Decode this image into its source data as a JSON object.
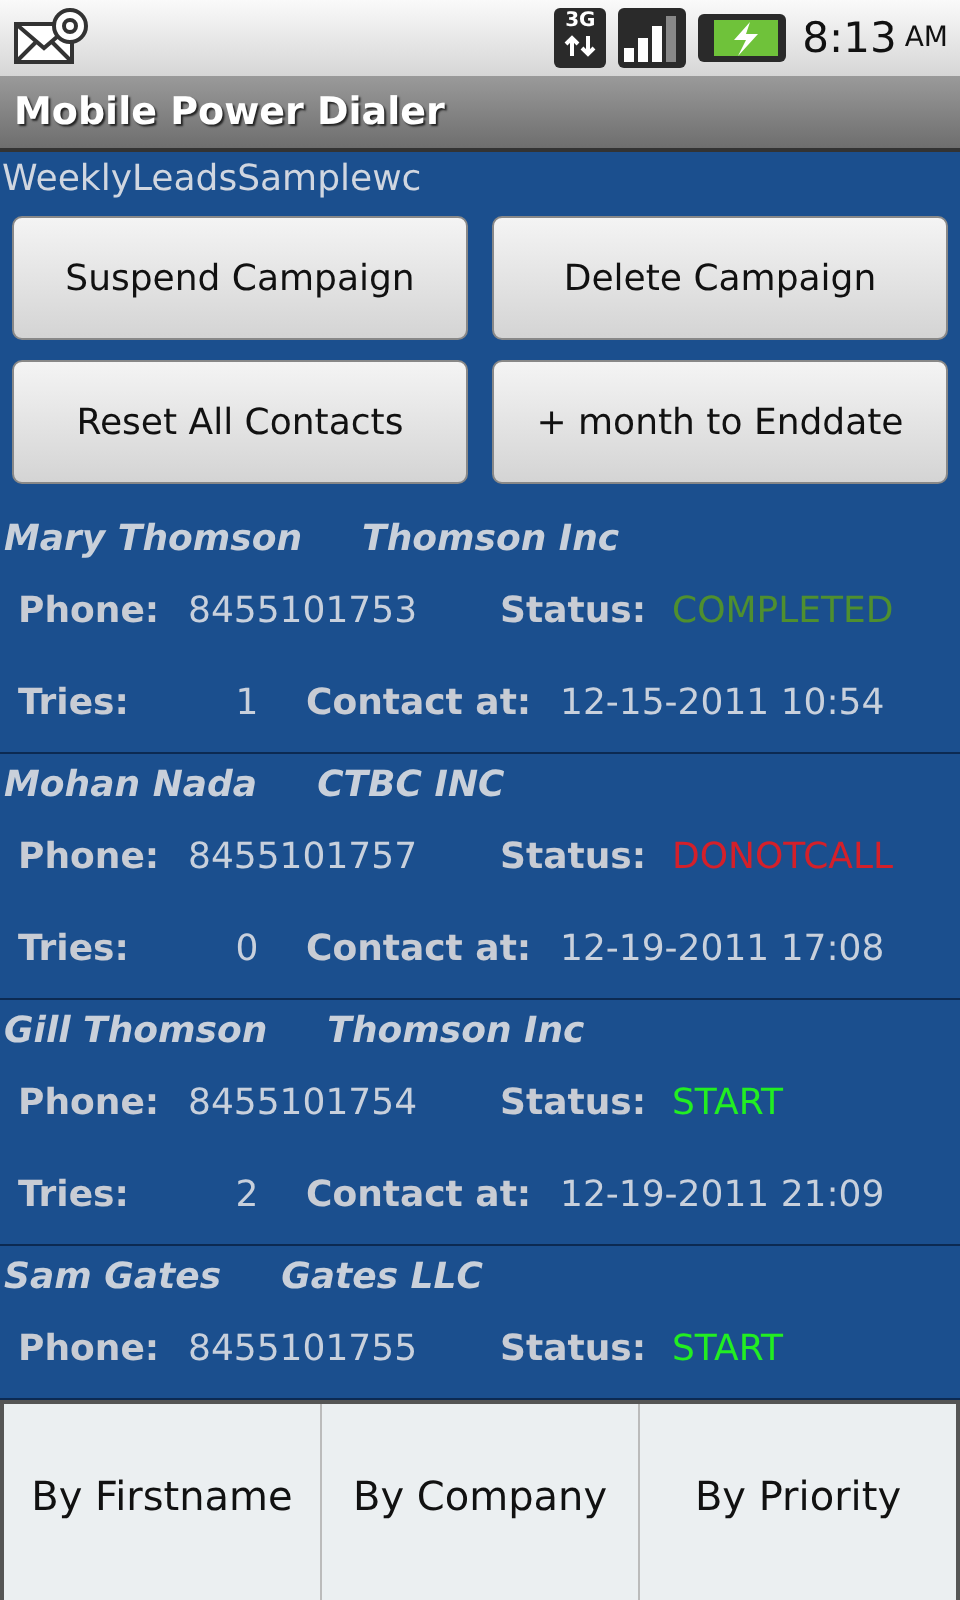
{
  "status_bar": {
    "time": "8:13",
    "ampm": "AM",
    "network": "3G"
  },
  "window": {
    "title": "Mobile Power Dialer"
  },
  "campaign": "WeeklyLeadsSamplewc",
  "buttons": [
    "Suspend Campaign",
    "Delete Campaign",
    "Reset All Contacts",
    "+ month to Enddate"
  ],
  "contacts": [
    {
      "name": "Mary Thomson",
      "company": "Thomson Inc",
      "phone_label": "Phone:",
      "phone": "8455101753",
      "status_label": "Status:",
      "status": "COMPLETED",
      "color": "#4f8f2f",
      "tries_label": "Tries:",
      "tries": "1",
      "contact_label": "Contact at:",
      "contact_at": "12-15-2011 10:54"
    },
    {
      "name": "Mohan Nada",
      "company": "CTBC INC",
      "phone_label": "Phone:",
      "phone": "8455101757",
      "status_label": "Status:",
      "status": "DONOTCALL",
      "color": "#d4202a",
      "tries_label": "Tries:",
      "tries": "0",
      "contact_label": "Contact at:",
      "contact_at": "12-19-2011 17:08"
    },
    {
      "name": "Gill Thomson",
      "company": "Thomson Inc",
      "phone_label": "Phone:",
      "phone": "8455101754",
      "status_label": "Status:",
      "status": "START",
      "color": "#22ee22",
      "tries_label": "Tries:",
      "tries": "2",
      "contact_label": "Contact at:",
      "contact_at": "12-19-2011 21:09"
    },
    {
      "name": "Sam Gates",
      "company": "Gates LLC",
      "phone_label": "Phone:",
      "phone": "8455101755",
      "status_label": "Status:",
      "status": "START",
      "color": "#22ee22"
    }
  ],
  "menu": [
    "By Firstname",
    "By Company",
    "By Priority"
  ]
}
